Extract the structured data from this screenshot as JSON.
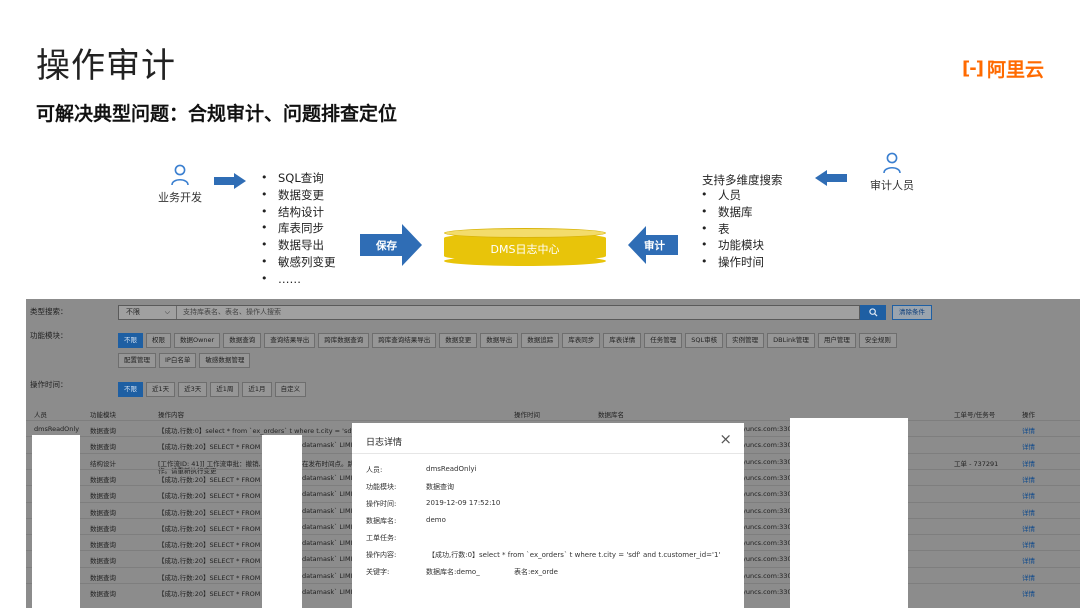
{
  "slide": {
    "title": "操作审计",
    "subtitle": "可解决典型问题：合规审计、问题排查定位",
    "brand_text": "阿里云",
    "brand_mark": "[-]",
    "accent_color": "#ff6a00",
    "primary_blue": "#2f6db5"
  },
  "diagram": {
    "left_actor": "业务开发",
    "right_actor": "审计人员",
    "left_features": [
      "SQL查询",
      "数据变更",
      "结构设计",
      "库表同步",
      "数据导出",
      "敏感列变更",
      "……"
    ],
    "center_label": "DMS日志中心",
    "save_arrow_label": "保存",
    "audit_arrow_label": "审计",
    "search_heading": "支持多维度搜索",
    "search_dimensions": [
      "人员",
      "数据库",
      "表",
      "功能模块",
      "操作时间"
    ]
  },
  "screenshot": {
    "filter_type_label": "类型搜索：",
    "filter_type_select": "不限",
    "filter_type_placeholder": "支持库表名、表名、操作人搜索",
    "clear_button": "清除条件",
    "module_label": "功能模块：",
    "modules_row1": [
      "不限",
      "权限",
      "数据Owner",
      "数据查询",
      "查询结果导出",
      "跨库数据查询",
      "跨库查询结果导出",
      "数据变更",
      "数据导出",
      "数据追踪",
      "库表同步",
      "库表详情",
      "任务管理",
      "SQL审核",
      "实例管理",
      "DBLink管理",
      "用户管理",
      "安全规则"
    ],
    "modules_row2": [
      "配置管理",
      "IP白名单",
      "敏感数据管理"
    ],
    "time_label": "操作时间：",
    "time_options": [
      "不限",
      "近1天",
      "近3天",
      "近1周",
      "近1月",
      "自定义"
    ],
    "columns": {
      "person": "人员",
      "module": "功能模块",
      "content": "操作内容",
      "time": "操作时间",
      "db": "数据库名",
      "ticket": "工单号/任务号",
      "action": "操作"
    },
    "rows": [
      {
        "person": "dmsReadOnly",
        "module": "数据查询",
        "content": "【成功,行数:0】select * from `ex_orders` t where t.city = 'sdf' and",
        "mid": "",
        "db": "yuncs.com:3306",
        "ticket": "",
        "action": "详情"
      },
      {
        "person": "",
        "module": "数据查询",
        "content": "【成功,行数:20】SELECT * FROM",
        "mid": "datamask` LIMIT",
        "db": "yuncs.com:330",
        "ticket": "",
        "action": "详情"
      },
      {
        "person": "",
        "module": "结构设计",
        "content": "[工作流ID: 41]] 工作流审批：撤销,",
        "content2": "作。请重新执行变更",
        "mid": "在发布时间点。跳",
        "db": "yuncs.com:330",
        "ticket": "工单 - 737291",
        "action": "详情"
      },
      {
        "person": "",
        "module": "数据查询",
        "content": "【成功,行数:20】SELECT * FROM",
        "mid": "datamask` LIMIT",
        "db": "yuncs.com:330",
        "ticket": "",
        "action": "详情"
      },
      {
        "person": "",
        "module": "数据查询",
        "content": "【成功,行数:20】SELECT * FROM",
        "mid": "datamask` LIMIT",
        "db": "yuncs.com:330",
        "ticket": "",
        "action": "详情"
      },
      {
        "person": "",
        "module": "数据查询",
        "content": "【成功,行数:20】SELECT * FROM",
        "mid": "datamask` LIMIT",
        "db": "yuncs.com:330",
        "ticket": "",
        "action": "详情"
      },
      {
        "person": "",
        "module": "数据查询",
        "content": "【成功,行数:20】SELECT * FROM",
        "mid": "datamask` LIMIT",
        "db": "yuncs.com:330",
        "ticket": "",
        "action": "详情"
      },
      {
        "person": "",
        "module": "数据查询",
        "content": "【成功,行数:20】SELECT * FROM",
        "mid": "datamask` LIMIT",
        "db": "yuncs.com:330",
        "ticket": "",
        "action": "详情"
      },
      {
        "person": "",
        "module": "数据查询",
        "content": "【成功,行数:20】SELECT * FROM",
        "mid": "datamask` LIMIT",
        "db": "yuncs.com:330",
        "ticket": "",
        "action": "详情"
      },
      {
        "person": "",
        "module": "数据查询",
        "content": "【成功,行数:20】SELECT * FROM",
        "mid": "datamask` LIMIT",
        "db": "yuncs.com:330",
        "ticket": "",
        "action": "详情"
      },
      {
        "person": "",
        "module": "数据查询",
        "content": "【成功,行数:20】SELECT * FROM",
        "mid": "datamask` LIMIT",
        "db": "yuncs.com:330",
        "ticket": "",
        "action": "详情"
      }
    ]
  },
  "modal": {
    "title": "日志详情",
    "close_glyph": "×",
    "fields": [
      {
        "k": "人员:",
        "v": "dmsReadOnlyi"
      },
      {
        "k": "功能模块:",
        "v": "数据查询"
      },
      {
        "k": "操作时间:",
        "v": "2019-12-09 17:52:10"
      },
      {
        "k": "数据库名:",
        "v": "demo"
      },
      {
        "k": "工单任务:",
        "v": ""
      },
      {
        "k": "操作内容:",
        "v": "【成功,行数:0】select * from `ex_orders` t where t.city = 'sdf' and t.customer_id='1'"
      },
      {
        "k": "关键字:",
        "v": "数据库名:demo_"
      }
    ],
    "keyword_table": "表名:ex_orde"
  }
}
